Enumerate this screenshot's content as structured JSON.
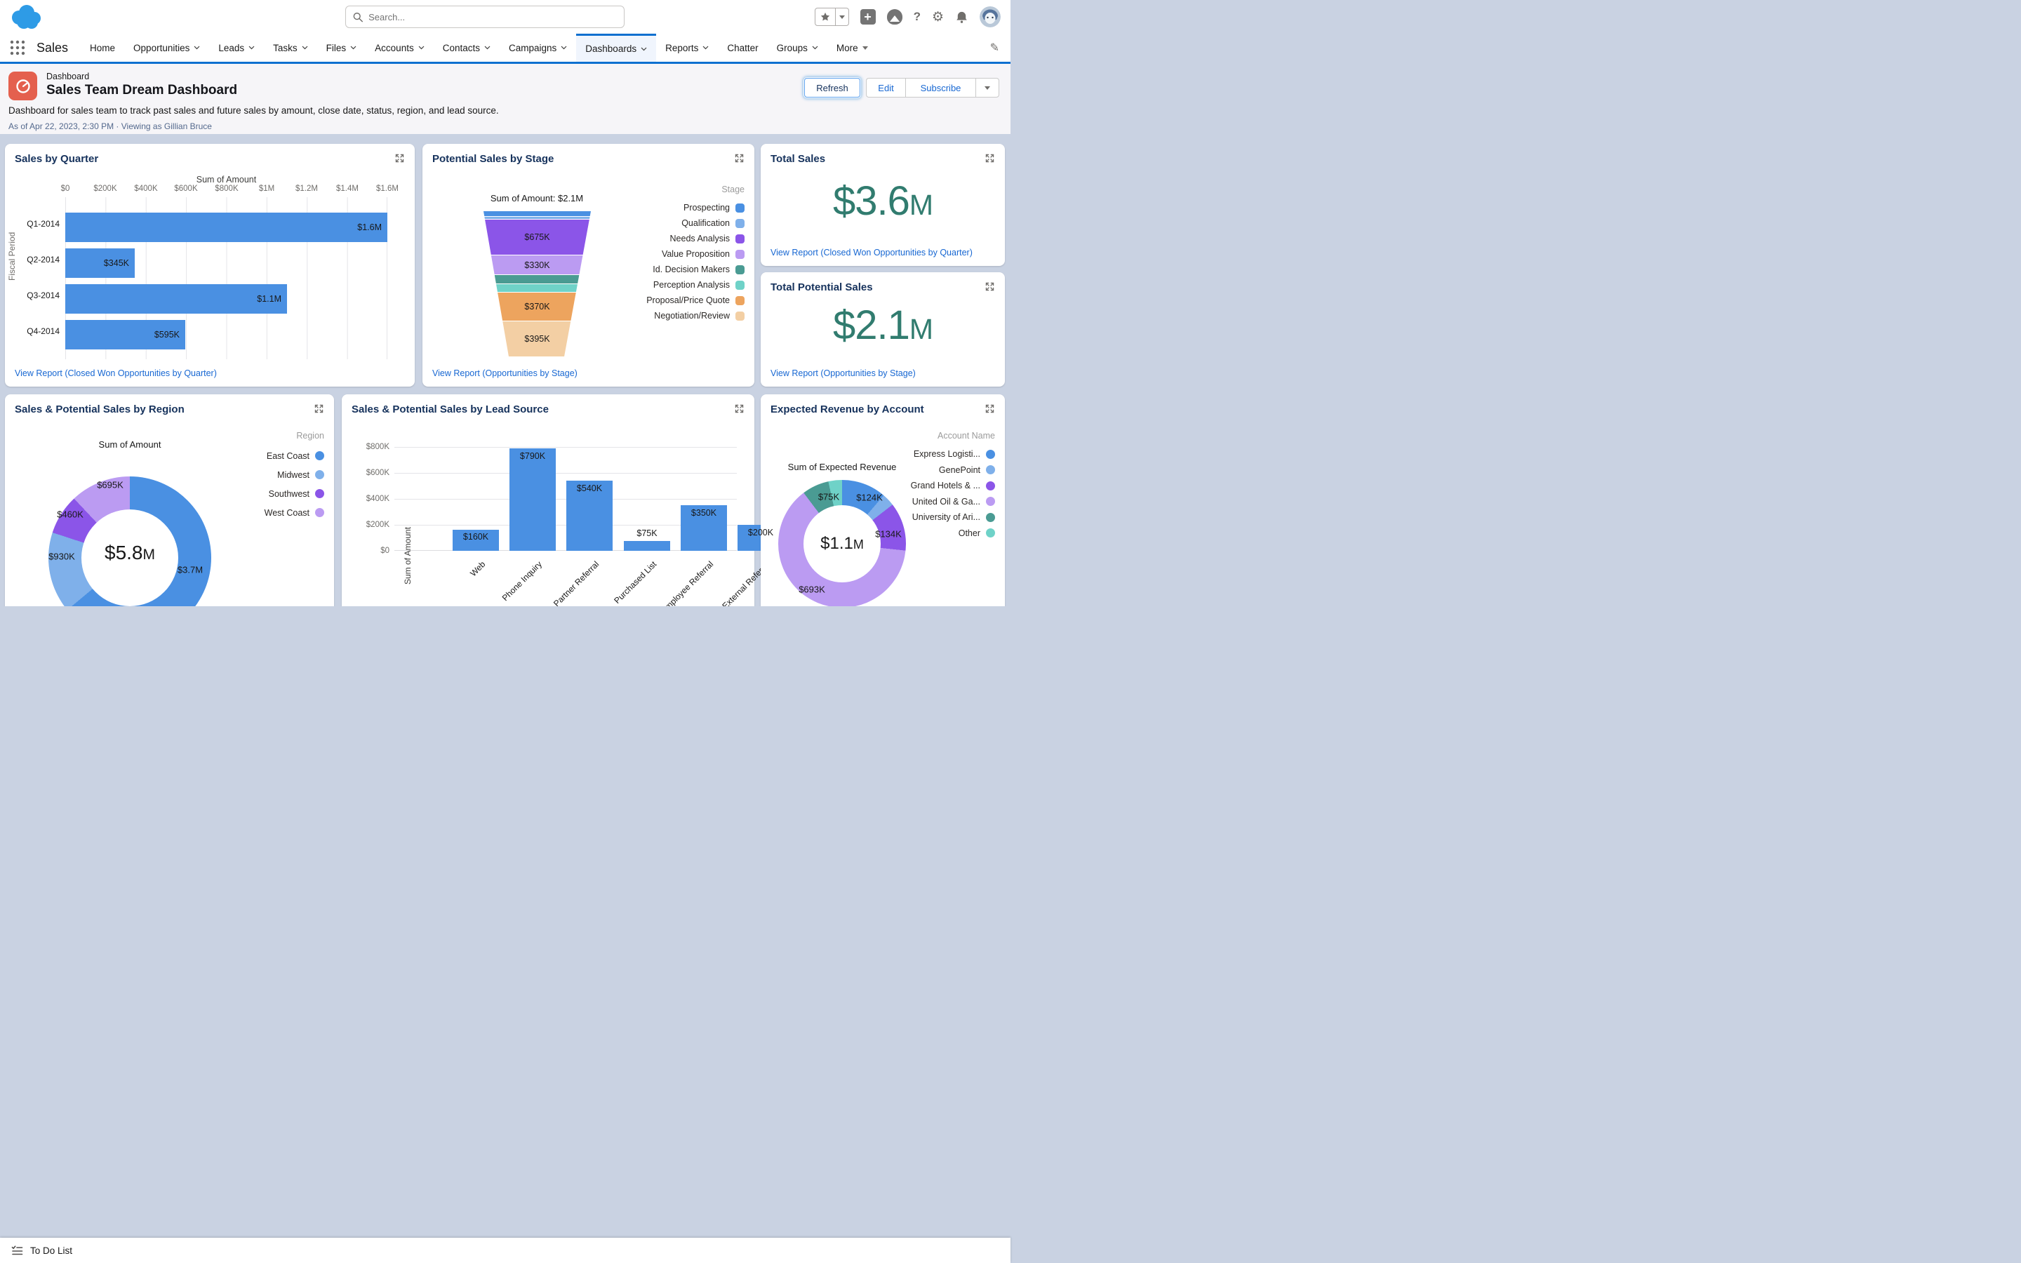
{
  "global_header": {
    "search_placeholder": "Search...",
    "icons": {
      "favorites": "star",
      "actions": "plus",
      "guidance": "mountain",
      "help": "question-mark",
      "setup": "gear",
      "notifications": "bell",
      "profile": "avatar"
    }
  },
  "app_nav": {
    "app_name": "Sales",
    "active_tab": "Dashboards",
    "tabs": [
      {
        "label": "Home"
      },
      {
        "label": "Opportunities"
      },
      {
        "label": "Leads"
      },
      {
        "label": "Tasks"
      },
      {
        "label": "Files"
      },
      {
        "label": "Accounts"
      },
      {
        "label": "Contacts"
      },
      {
        "label": "Campaigns"
      },
      {
        "label": "Dashboards"
      },
      {
        "label": "Reports"
      },
      {
        "label": "Chatter"
      },
      {
        "label": "Groups"
      },
      {
        "label": "More"
      }
    ]
  },
  "page_header": {
    "eyebrow": "Dashboard",
    "title": "Sales Team Dream Dashboard",
    "description": "Dashboard for sales team to track past sales and future sales by amount, close date, status, region, and lead source.",
    "as_of": "As of Apr 22, 2023, 2:30 PM · Viewing as Gillian Bruce",
    "buttons": {
      "refresh": "Refresh",
      "edit": "Edit",
      "subscribe": "Subscribe"
    }
  },
  "colors": {
    "accent_blue": "#4a90e2",
    "light_blue": "#7fb0ea",
    "purple": "#8b55e8",
    "light_purple": "#bb9bf2",
    "teal": "#4a9b93",
    "light_teal": "#6fd2c8",
    "orange": "#eda45e",
    "tan": "#f3cfa4",
    "kpi_green": "#317c6f",
    "nav_blue": "#0d70d0",
    "link_blue": "#1767d2",
    "title_navy": "#16325c"
  },
  "chart_data": [
    {
      "type": "bar",
      "title": "Sales by Quarter",
      "xlabel": "Sum of Amount",
      "ylabel": "Fiscal Period",
      "categories": [
        "Q1-2014",
        "Q2-2014",
        "Q3-2014",
        "Q4-2014"
      ],
      "values": [
        1600000,
        345000,
        1100000,
        595000
      ],
      "xlim": [
        0,
        1600000
      ]
    },
    {
      "type": "funnel",
      "title": "Potential Sales by Stage",
      "total": "Sum of Amount: $2.1M",
      "categories": [
        "Prospecting",
        "Qualification",
        "Needs Analysis",
        "Value Proposition",
        "Id. Decision Makers",
        "Perception Analysis",
        "Proposal/Price Quote",
        "Negotiation/Review"
      ],
      "labeled_values": {
        "Needs Analysis": 675000,
        "Value Proposition": 330000,
        "Proposal/Price Quote": 370000,
        "Negotiation/Review": 395000
      }
    },
    {
      "type": "pie",
      "title": "Sales & Potential Sales by Region",
      "categories": [
        "East Coast",
        "Midwest",
        "Southwest",
        "West Coast"
      ],
      "values": [
        3700000,
        930000,
        460000,
        695000
      ],
      "center_total": 5800000
    },
    {
      "type": "bar",
      "title": "Sales & Potential Sales by Lead Source",
      "ylabel": "Sum of Amount",
      "ylim": [
        0,
        800000
      ],
      "categories": [
        "Web",
        "Phone Inquiry",
        "Partner Referral",
        "Purchased List",
        "Employee Referral",
        "External Referral"
      ],
      "values": [
        160000,
        790000,
        540000,
        75000,
        350000,
        200000
      ]
    },
    {
      "type": "pie",
      "title": "Expected Revenue by Account",
      "categories": [
        "Express Logisti...",
        "GenePoint",
        "Grand Hotels & ...",
        "United Oil & Ga...",
        "University of Ari...",
        "Other"
      ],
      "values": [
        124000,
        35000,
        134000,
        693000,
        75000,
        40000
      ],
      "center_total": 1100000
    }
  ],
  "cards": {
    "quarter": {
      "title": "Sales by Quarter",
      "axis_title": "Sum of Amount",
      "y_axis_label": "Fiscal Period",
      "ticks": [
        "$0",
        "$200K",
        "$400K",
        "$600K",
        "$800K",
        "$1M",
        "$1.2M",
        "$1.4M",
        "$1.6M"
      ],
      "bars": [
        {
          "category": "Q1-2014",
          "label": "$1.6M"
        },
        {
          "category": "Q2-2014",
          "label": "$345K"
        },
        {
          "category": "Q3-2014",
          "label": "$1.1M"
        },
        {
          "category": "Q4-2014",
          "label": "$595K"
        }
      ],
      "link": "View Report (Closed Won Opportunities by Quarter)"
    },
    "stage": {
      "title": "Potential Sales by Stage",
      "subtitle": "Sum of Amount: $2.1M",
      "legend_title": "Stage",
      "segments": [
        {
          "stage": "Prospecting",
          "label": ""
        },
        {
          "stage": "Qualification",
          "label": ""
        },
        {
          "stage": "Needs Analysis",
          "label": "$675K"
        },
        {
          "stage": "Value Proposition",
          "label": "$330K"
        },
        {
          "stage": "Id. Decision Makers",
          "label": ""
        },
        {
          "stage": "Perception Analysis",
          "label": ""
        },
        {
          "stage": "Proposal/Price Quote",
          "label": "$370K"
        },
        {
          "stage": "Negotiation/Review",
          "label": "$395K"
        }
      ],
      "link": "View Report (Opportunities by Stage)"
    },
    "total_sales": {
      "title": "Total Sales",
      "value": "$3.6",
      "unit": "M",
      "link": "View Report (Closed Won Opportunities by Quarter)"
    },
    "total_potential": {
      "title": "Total Potential Sales",
      "value": "$2.1",
      "unit": "M",
      "link": "View Report (Opportunities by Stage)"
    },
    "region": {
      "title": "Sales & Potential Sales by Region",
      "subtitle": "Sum of Amount",
      "legend_title": "Region",
      "center_value": "$5.8",
      "center_unit": "M",
      "slices": [
        {
          "name": "East Coast",
          "label": "$3.7M"
        },
        {
          "name": "Midwest",
          "label": "$930K"
        },
        {
          "name": "Southwest",
          "label": "$460K"
        },
        {
          "name": "West Coast",
          "label": "$695K"
        }
      ]
    },
    "lead_source": {
      "title": "Sales & Potential Sales by Lead Source",
      "y_axis_label": "Sum of Amount",
      "y_ticks": [
        "$800K",
        "$600K",
        "$400K",
        "$200K",
        "$0"
      ],
      "bars": [
        {
          "category": "Web",
          "label": "$160K"
        },
        {
          "category": "Phone Inquiry",
          "label": "$790K"
        },
        {
          "category": "Partner Referral",
          "label": "$540K"
        },
        {
          "category": "Purchased List",
          "label": "$75K"
        },
        {
          "category": "Employee Referral",
          "label": "$350K"
        },
        {
          "category": "External Referral",
          "label": "$200K"
        }
      ]
    },
    "account": {
      "title": "Expected Revenue by Account",
      "subtitle": "Sum of Expected Revenue",
      "legend_title": "Account Name",
      "center_value": "$1.1",
      "center_unit": "M",
      "slices": [
        {
          "name": "Express Logisti...",
          "label": "$124K"
        },
        {
          "name": "GenePoint",
          "label": ""
        },
        {
          "name": "Grand Hotels & ...",
          "label": "$134K"
        },
        {
          "name": "United Oil & Ga...",
          "label": "$693K"
        },
        {
          "name": "University of Ari...",
          "label": "$75K"
        },
        {
          "name": "Other",
          "label": ""
        }
      ]
    }
  },
  "footer": {
    "todo_label": "To Do List"
  }
}
